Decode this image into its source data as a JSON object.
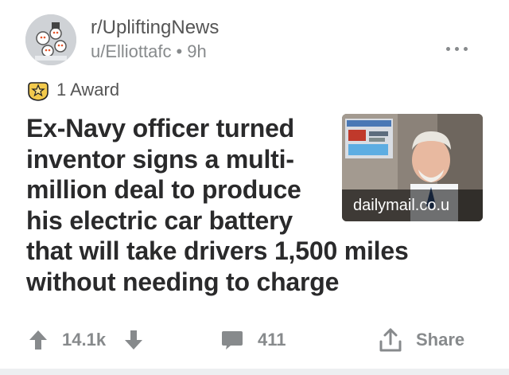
{
  "post": {
    "subreddit": "r/UpliftingNews",
    "author": "u/Elliottafc",
    "age": "9h",
    "award_label": "1 Award",
    "title_lines": [
      "Ex-Navy officer turned",
      "inventor signs a multi-",
      "million deal to produce",
      "his electric car battery",
      "that will take drivers 1,500 miles",
      "without needing to charge"
    ],
    "thumbnail_domain": "dailymail.co.u"
  },
  "actions": {
    "upvote_count": "14.1k",
    "comment_count": "411",
    "share_label": "Share"
  },
  "icons": {
    "avatar": "subreddit-avatar-icon",
    "award": "award-icon",
    "more": "more-options-icon",
    "upvote": "upvote-icon",
    "downvote": "downvote-icon",
    "comment": "comment-icon",
    "share": "share-icon"
  },
  "colors": {
    "meta_text": "#878a8c",
    "title_text": "#2a2a2b",
    "award_gold": "#f2c94c"
  }
}
